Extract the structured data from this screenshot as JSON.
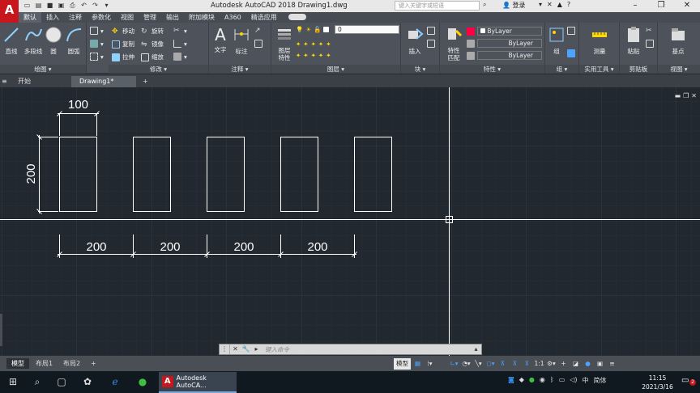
{
  "titlebar": {
    "app_logo": "A",
    "title": "Autodesk AutoCAD 2018    Drawing1.dwg",
    "search_placeholder": "键入关键字或短语",
    "login": "登录"
  },
  "ribbon_tabs": [
    {
      "label": "默认",
      "active": true
    },
    {
      "label": "插入"
    },
    {
      "label": "注释"
    },
    {
      "label": "参数化"
    },
    {
      "label": "视图"
    },
    {
      "label": "管理"
    },
    {
      "label": "输出"
    },
    {
      "label": "附加模块"
    },
    {
      "label": "A360"
    },
    {
      "label": "精选应用"
    }
  ],
  "ribbon": {
    "draw": {
      "title": "绘图 ▾",
      "line": "直线",
      "polyline": "多段线",
      "circle": "圆",
      "arc": "圆弧"
    },
    "modify": {
      "title": "修改 ▾",
      "move": "移动",
      "rotate": "旋转",
      "copy": "复制",
      "mirror": "镜像",
      "stretch": "拉伸",
      "scale": "缩放"
    },
    "annotation": {
      "title": "注释 ▾",
      "text": "文字",
      "dimension": "标注"
    },
    "layers": {
      "title": "图层 ▾",
      "layer_props": "图层\n特性",
      "layer_value": "0"
    },
    "block": {
      "title": "块 ▾",
      "insert": "插入"
    },
    "properties": {
      "title": "特性 ▾",
      "match": "特性\n匹配",
      "color": "ByLayer",
      "linetype": "ByLayer",
      "lineweight": "ByLayer"
    },
    "groups": {
      "title": "组 ▾",
      "group": "组"
    },
    "utilities": {
      "title": "实用工具 ▾",
      "measure": "测量"
    },
    "clipboard": {
      "title": "剪贴板",
      "paste": "粘贴"
    },
    "view": {
      "title": "视图 ▾",
      "base": "基点"
    }
  },
  "file_tabs": {
    "start": "开始",
    "drawing": "Drawing1*",
    "new": "+"
  },
  "drawing": {
    "dim_width": "100",
    "dim_height": "200",
    "dim_spacing": [
      "200",
      "200",
      "200",
      "200"
    ]
  },
  "command_line": {
    "placeholder": "键入命令"
  },
  "layout_tabs": [
    {
      "label": "模型",
      "active": true
    },
    {
      "label": "布局1"
    },
    {
      "label": "布局2"
    },
    {
      "label": "+"
    }
  ],
  "statusbar": {
    "model": "模型",
    "scale": "1:1"
  },
  "taskbar": {
    "app_label": "Autodesk AutoCA...",
    "ime": "简体",
    "time": "11:15",
    "date": "2021/3/16",
    "notif_count": "2"
  }
}
